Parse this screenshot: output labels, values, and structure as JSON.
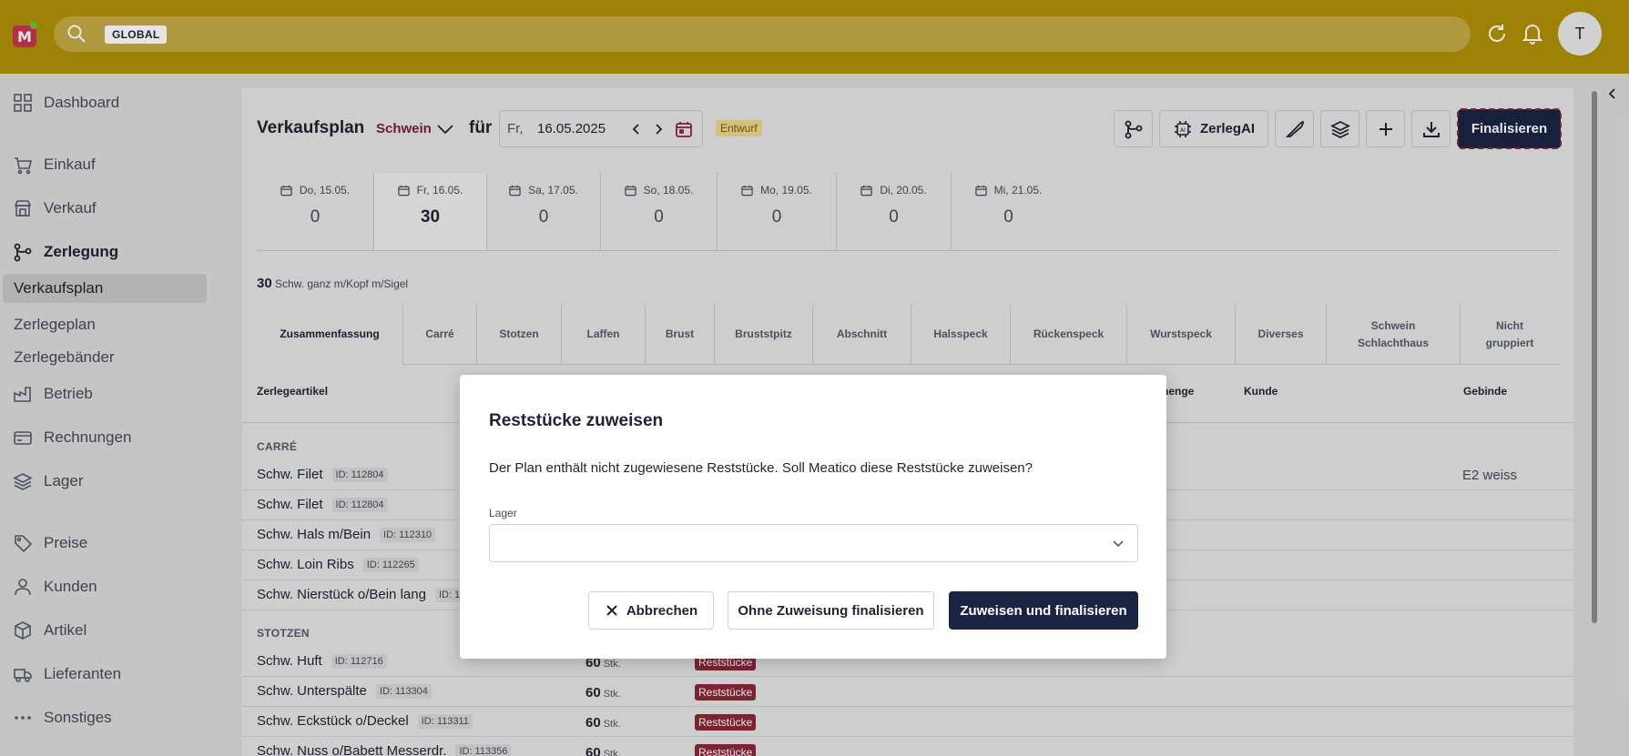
{
  "header": {
    "search_scope": "GLOBAL",
    "avatar_initial": "T",
    "brand_color": "#b09008"
  },
  "sidebar": {
    "items": [
      {
        "label": "Dashboard",
        "icon": "grid-icon"
      },
      {
        "label": "Einkauf",
        "icon": "cart-icon"
      },
      {
        "label": "Verkauf",
        "icon": "store-icon"
      },
      {
        "label": "Zerlegung",
        "icon": "branch-icon"
      },
      {
        "label": "Betrieb",
        "icon": "factory-icon"
      },
      {
        "label": "Rechnungen",
        "icon": "invoice-icon"
      },
      {
        "label": "Lager",
        "icon": "layers-icon"
      },
      {
        "label": "Preise",
        "icon": "tag-icon"
      },
      {
        "label": "Kunden",
        "icon": "user-icon"
      },
      {
        "label": "Artikel",
        "icon": "box-icon"
      },
      {
        "label": "Lieferanten",
        "icon": "truck-icon"
      },
      {
        "label": "Sonstiges",
        "icon": "more-icon"
      }
    ],
    "subitems": [
      "Verkaufsplan",
      "Zerlegeplan",
      "Zerlegebänder"
    ]
  },
  "page": {
    "title": "Verkaufsplan",
    "species": "Schwein",
    "for_label": "für",
    "date_day": "Fr,",
    "date_value": "16.05.2025",
    "status": "Entwurf",
    "ai_button": "ZerlegAI",
    "finalize_button": "Finalisieren"
  },
  "days": [
    {
      "label": "Do, 15.05.",
      "count": "0"
    },
    {
      "label": "Fr, 16.05.",
      "count": "30"
    },
    {
      "label": "Sa, 17.05.",
      "count": "0"
    },
    {
      "label": "So, 18.05.",
      "count": "0"
    },
    {
      "label": "Mo, 19.05.",
      "count": "0"
    },
    {
      "label": "Di, 20.05.",
      "count": "0"
    },
    {
      "label": "Mi, 21.05.",
      "count": "0"
    }
  ],
  "summary": {
    "count": "30",
    "text": "Schw. ganz m/Kopf m/Sigel"
  },
  "categories": [
    "Zusammenfassung",
    "Carré",
    "Stotzen",
    "Laffen",
    "Brust",
    "Bruststpitz",
    "Abschnitt",
    "Halsspeck",
    "Rückenspeck",
    "Wurstspeck",
    "Diverses",
    "Schwein Schlachthaus",
    "Nicht gruppiert"
  ],
  "table_headers": {
    "article": "Zerlegeartikel",
    "partial": "ilmenge",
    "customer": "Kunde",
    "container": "Gebinde"
  },
  "groups": [
    {
      "label": "CARRÉ",
      "rows": [
        {
          "name": "Schw. Filet",
          "id": "ID: 112804",
          "container": "E2 weiss"
        },
        {
          "name": "Schw. Filet",
          "id": "ID: 112804"
        },
        {
          "name": "Schw. Hals m/Bein",
          "id": "ID: 112310"
        },
        {
          "name": "Schw. Loin Ribs",
          "id": "ID: 112265"
        },
        {
          "name": "Schw. Nierstück o/Bein lang",
          "id": "ID: 1"
        }
      ]
    },
    {
      "label": "STOTZEN",
      "rows": [
        {
          "name": "Schw. Huft",
          "id": "ID: 112716",
          "qty": "60",
          "unit": "Stk.",
          "tag": "Reststücke"
        },
        {
          "name": "Schw. Unterspälte",
          "id": "ID: 113304",
          "qty": "60",
          "unit": "Stk.",
          "tag": "Reststücke"
        },
        {
          "name": "Schw. Eckstück o/Deckel",
          "id": "ID: 113311",
          "qty": "60",
          "unit": "Stk.",
          "tag": "Reststücke"
        },
        {
          "name": "Schw. Nuss o/Babett Messerdr.",
          "id": "ID: 113356",
          "qty": "60",
          "unit": "Stk.",
          "tag": "Reststücke"
        }
      ]
    }
  ],
  "modal": {
    "title": "Reststücke zuweisen",
    "message": "Der Plan enthält nicht zugewiesene Reststücke. Soll Meatico diese Reststücke zuweisen?",
    "field_label": "Lager",
    "field_value": "",
    "cancel": "Abbrechen",
    "finalize_without": "Ohne Zuweisung finalisieren",
    "assign_and_finalize": "Zuweisen und finalisieren"
  }
}
